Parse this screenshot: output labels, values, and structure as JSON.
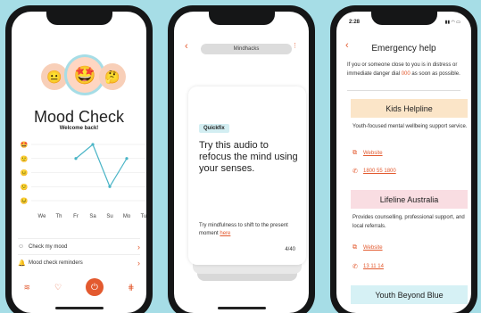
{
  "mood": {
    "title": "Mood Check",
    "subtitle": "Welcome back!",
    "faces": [
      "😐",
      "🤩",
      "🤔"
    ],
    "scale": [
      "🤩",
      "🙂",
      "😐",
      "😕",
      "😣"
    ],
    "menu": [
      {
        "icon": "☺",
        "label": "Check my mood"
      },
      {
        "icon": "🔔",
        "label": "Mood check reminders"
      }
    ]
  },
  "mindhacks": {
    "header": "Mindhacks",
    "tag": "Quickfix",
    "card_title": "Try this audio to refocus the mind using your senses.",
    "note": "Try mindfulness to shift to the present moment",
    "note_link": "here",
    "counter": "4/40"
  },
  "emergency": {
    "time": "2:28",
    "title": "Emergency help",
    "intro_pre": "If you or someone close to you is in distress or immediate danger dial",
    "intro_num": "000",
    "intro_post": "as soon as possible.",
    "services": [
      {
        "name": "Kids Helpline",
        "desc": "Youth-focused mental wellbeing support service.",
        "website": "Website",
        "phone": "1800 55 1800",
        "color": "#fbe5c8"
      },
      {
        "name": "Lifeline Australia",
        "desc": "Provides counselling, professional support, and local referrals.",
        "website": "Website",
        "phone": "13 11 14",
        "color": "#f9dde2"
      },
      {
        "name": "Youth Beyond Blue",
        "color": "#d6f1f5"
      }
    ]
  },
  "chart_data": {
    "type": "line",
    "categories": [
      "We",
      "Th",
      "Fr",
      "Sa",
      "Su",
      "Mo",
      "Tu"
    ],
    "values": [
      null,
      null,
      4,
      5,
      2,
      4,
      null
    ],
    "ylabels": [
      "🤩",
      "🙂",
      "😐",
      "😕",
      "😣"
    ],
    "ylim": [
      1,
      5
    ]
  },
  "colors": {
    "accent": "#e35a2f",
    "background": "#a6dde6",
    "line": "#49b4c6"
  }
}
